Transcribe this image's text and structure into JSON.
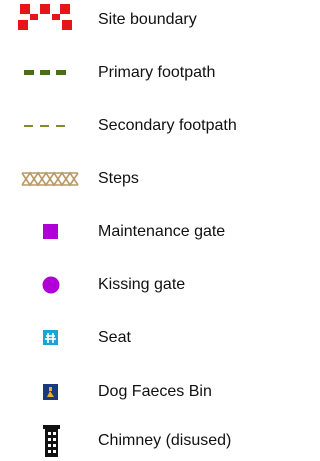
{
  "legend": {
    "items": [
      {
        "label": "Site boundary",
        "symbol": "red-dashed-boundary",
        "color": "#e8141c"
      },
      {
        "label": "Primary footpath",
        "symbol": "green-dashed-line",
        "color": "#4b6b1e"
      },
      {
        "label": "Secondary footpath",
        "symbol": "olive-dashed-line",
        "color": "#8a8a2a"
      },
      {
        "label": "Steps",
        "symbol": "crosshatch-band",
        "color": "#b79a68"
      },
      {
        "label": "Maintenance gate",
        "symbol": "purple-square",
        "color": "#b000d8"
      },
      {
        "label": "Kissing gate",
        "symbol": "purple-circle",
        "color": "#b000d8"
      },
      {
        "label": "Seat",
        "symbol": "seat-icon",
        "color": "#1aa4d8"
      },
      {
        "label": "Dog Faeces Bin",
        "symbol": "dog-bin-icon",
        "color": "#1a3a7a"
      },
      {
        "label": "Chimney (disused)",
        "symbol": "chimney-icon",
        "color": "#111111"
      }
    ]
  }
}
